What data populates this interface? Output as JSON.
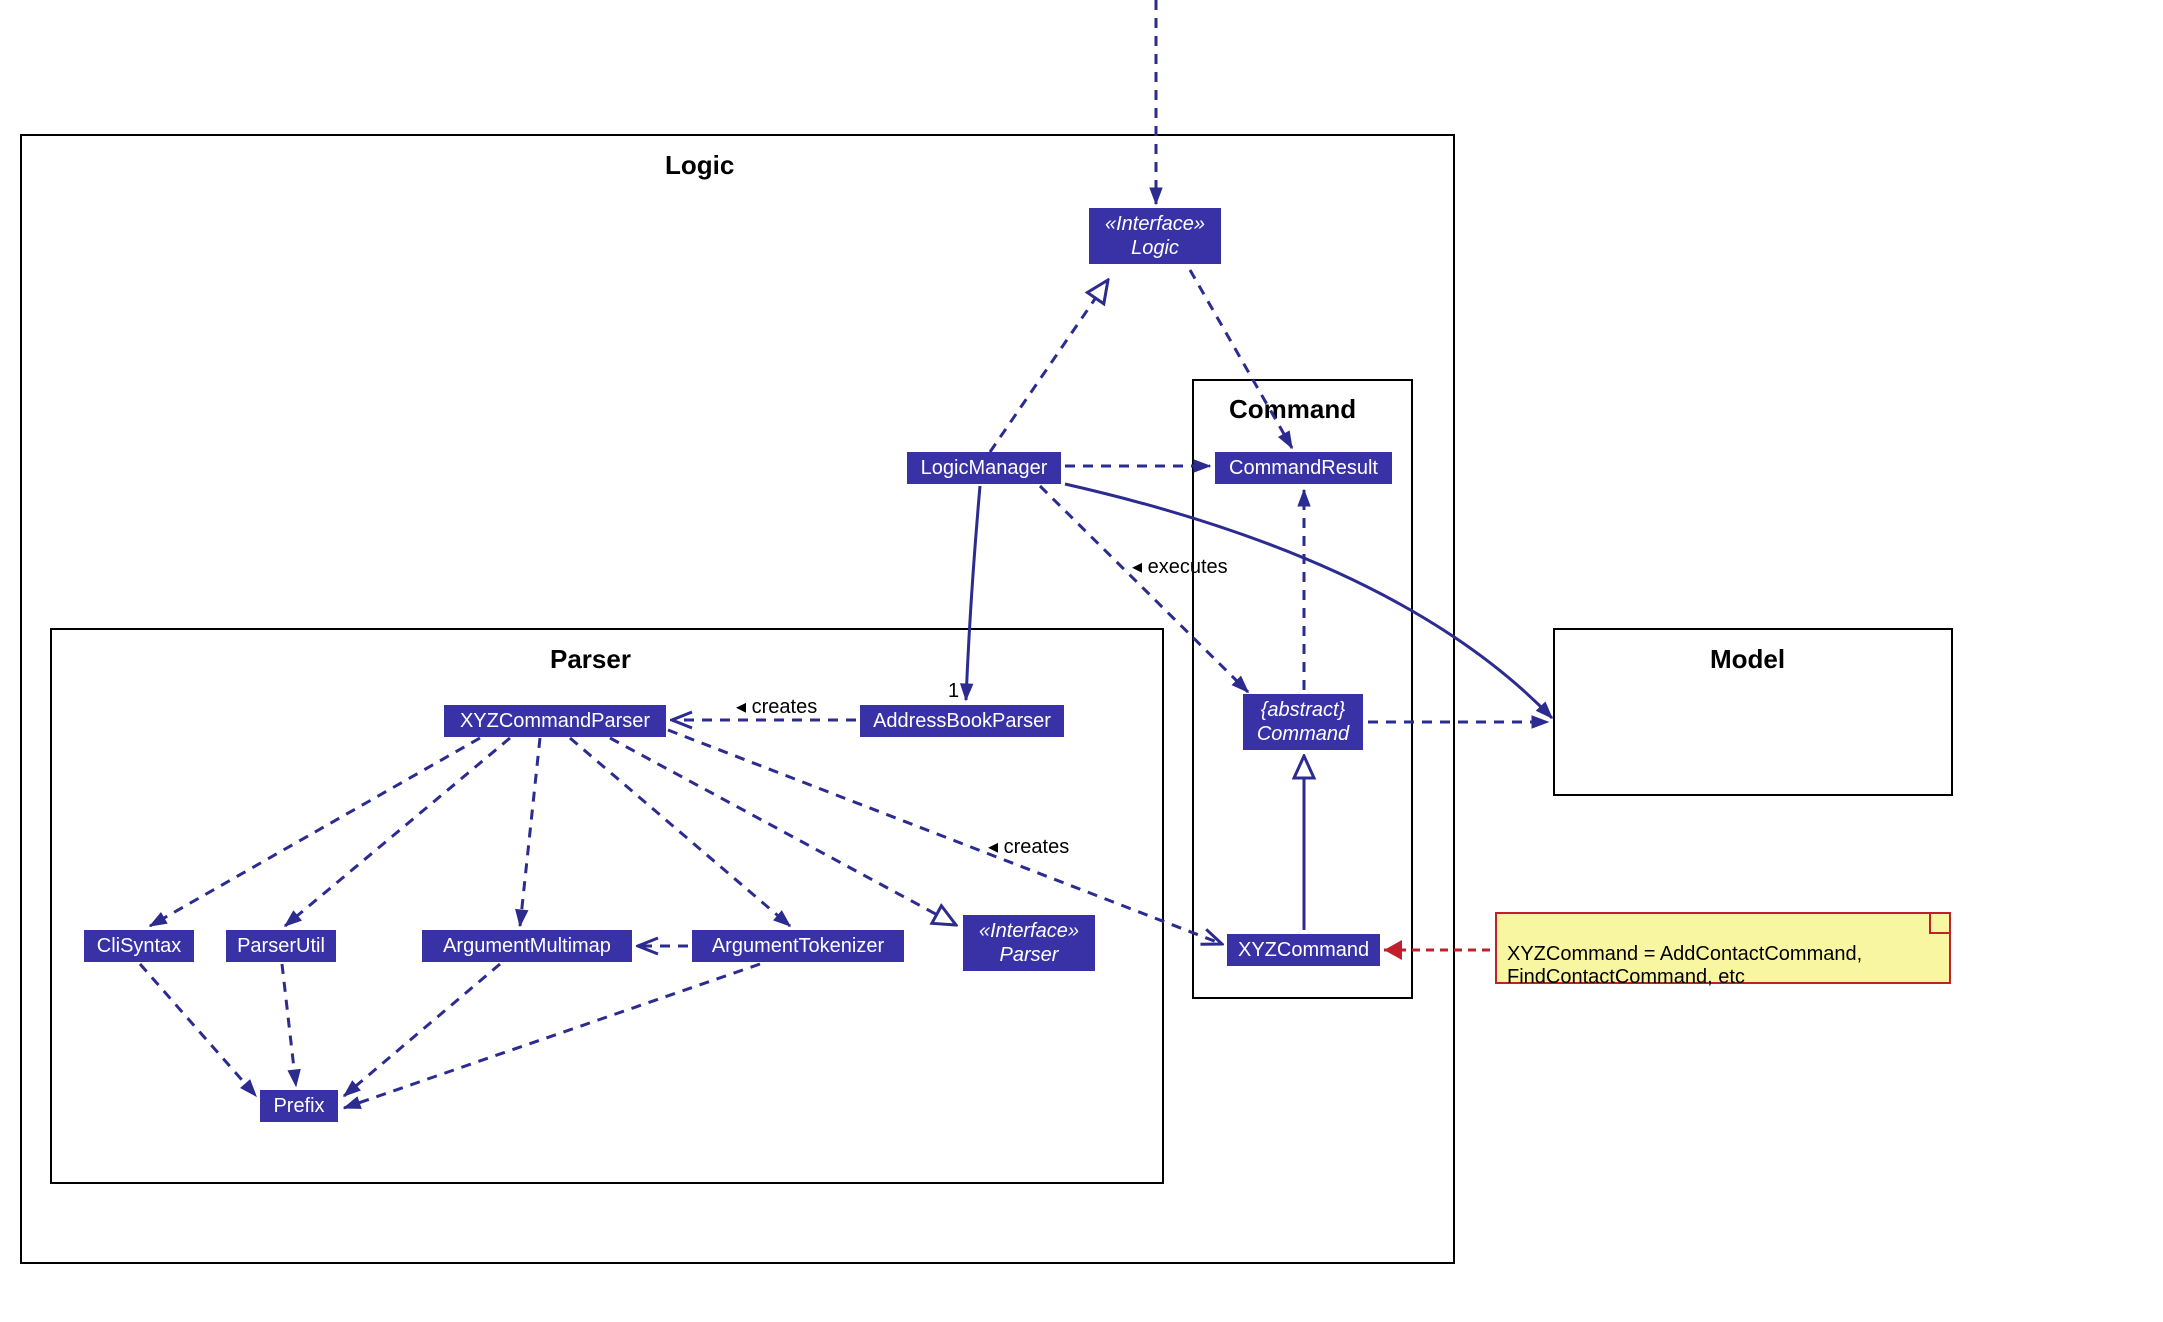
{
  "packages": {
    "logic": "Logic",
    "parser": "Parser",
    "command": "Command",
    "model": "Model"
  },
  "classes": {
    "logicInterface": {
      "stereo": "«Interface»",
      "name": "Logic"
    },
    "logicManager": "LogicManager",
    "addressBookParser": "AddressBookParser",
    "xyzCommandParser": "XYZCommandParser",
    "cliSyntax": "CliSyntax",
    "parserUtil": "ParserUtil",
    "argumentMultimap": "ArgumentMultimap",
    "argumentTokenizer": "ArgumentTokenizer",
    "parserInterface": {
      "stereo": "«Interface»",
      "name": "Parser"
    },
    "prefix": "Prefix",
    "commandResult": "CommandResult",
    "abstractCommand": {
      "stereo": "{abstract}",
      "name": "Command"
    },
    "xyzCommand": "XYZCommand"
  },
  "labels": {
    "creates1": "creates",
    "creates2": "creates",
    "executes": "executes",
    "one": "1"
  },
  "note": "XYZCommand = AddContactCommand,\nFindContactCommand, etc"
}
